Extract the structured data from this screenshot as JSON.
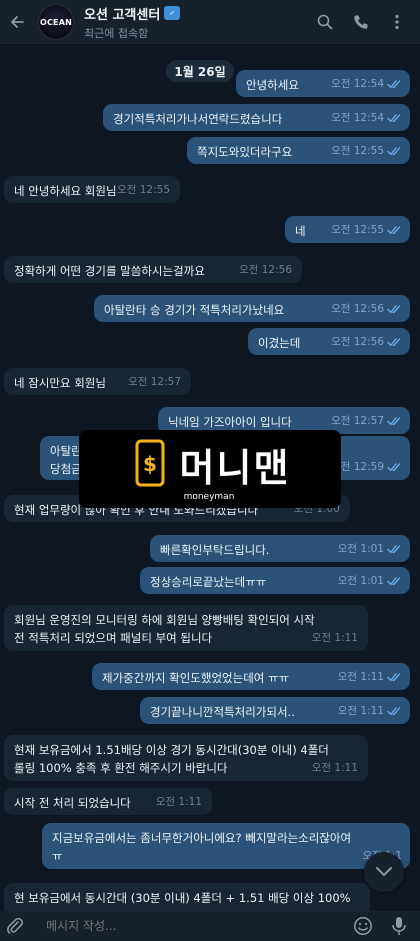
{
  "header": {
    "avatar_text": "OCEAN",
    "title": "오션 고객센터",
    "status": "최근에 접속함"
  },
  "chat": {
    "date_label": "1월 26일",
    "messages": [
      {
        "dir": "out",
        "text": "안녕하세요",
        "time": "오전 12:54",
        "read": true
      },
      {
        "dir": "out",
        "text": "경기적특처리가나서연락드렸습니다",
        "time": "오전 12:54",
        "read": true
      },
      {
        "dir": "out",
        "text": "쪽지도와있더라구요",
        "time": "오전 12:55",
        "read": true
      },
      {
        "dir": "in",
        "text": "네 안녕하세요 회원님",
        "time": "오전 12:55"
      },
      {
        "dir": "out",
        "text": "네",
        "time": "오전 12:55",
        "read": true
      },
      {
        "dir": "in",
        "text": "정확하게 어떤 경기를 말씀하시는걸까요",
        "time": "오전 12:56"
      },
      {
        "dir": "out",
        "text": "아탈란타 승 경기가 적특처리가났네요",
        "time": "오전 12:56",
        "read": true
      },
      {
        "dir": "out",
        "text": "이겼는데",
        "time": "오전 12:56",
        "read": true
      },
      {
        "dir": "in",
        "text": "네 잠시만요 회원님",
        "time": "오전 12:57"
      },
      {
        "dir": "out",
        "text": "닉네임 가즈아아이 입니다",
        "time": "오전 12:57",
        "read": true
      },
      {
        "dir": "out",
        "text": "아탈란\n당첨금",
        "time": "오전 12:59",
        "read": true
      },
      {
        "dir": "in",
        "text": "현재 업무량이 많아 확인 후 안내 도와드리겠습니다",
        "time": "오전 1:00"
      },
      {
        "dir": "out",
        "text": "빠른확인부탁드립니다.",
        "time": "오전 1:01",
        "read": true
      },
      {
        "dir": "out",
        "text": "정상승리로끝났는데ㅠㅠ",
        "time": "오전 1:01",
        "read": true
      },
      {
        "dir": "in",
        "text": "회원님 운영진의 모니터링 하에 회원님 양빵배팅 확인되어 시작\n전 적특처리 되었으며 패널티 부여 됩니다",
        "time": "오전 1:11"
      },
      {
        "dir": "out",
        "text": "제가중간까지 확인도했었었는데여 ㅠㅠ",
        "time": "오전 1:11",
        "read": true
      },
      {
        "dir": "out",
        "text": "경기끝나니깐적특처리가되서..",
        "time": "오전 1:11",
        "read": true
      },
      {
        "dir": "in",
        "text": "현재 보유금에서 1.51배당 이상 경기 동시간대(30분 이내) 4폴더\n롤링 100% 충족 후 환전 해주시기 바랍니다",
        "time": "오전 1:11"
      },
      {
        "dir": "in",
        "text": "시작 전 처리 되었습니다",
        "time": "오전 1:11"
      },
      {
        "dir": "out",
        "text": "지금보유금에서는 좀너무한거아니에요? 빼지말라는소리잖아여\nㅠ",
        "time": "오전 1:1",
        "read": true
      },
      {
        "dir": "in",
        "text": "현 보유금에서 동시간대 (30분 이내) 4폴더 + 1.51 배당 이상 100%",
        "time": ""
      }
    ]
  },
  "watermark": {
    "brand_text": "머니맨",
    "sub_text": "moneyman"
  },
  "composer": {
    "placeholder": "메시지 작성..."
  },
  "icons": {
    "back": "back-arrow-icon",
    "search": "search-icon",
    "call": "phone-icon",
    "menu": "more-vertical-icon",
    "attach": "paperclip-icon",
    "emoji": "emoji-icon",
    "mic": "microphone-icon",
    "scroll": "chevron-down-icon"
  },
  "colors": {
    "background": "#0e1621",
    "header": "#17212b",
    "outgoing_bubble": "#2b5278",
    "incoming_bubble": "#182533",
    "tick": "#7ea6cb",
    "watermark_accent": "#f5b31b"
  }
}
